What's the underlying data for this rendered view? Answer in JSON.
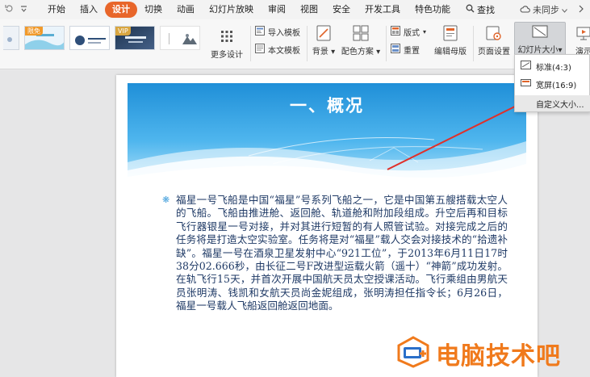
{
  "menubar": {
    "tabs": [
      {
        "label": "开始"
      },
      {
        "label": "插入"
      },
      {
        "label": "设计",
        "active": true
      },
      {
        "label": "切换"
      },
      {
        "label": "动画"
      },
      {
        "label": "幻灯片放映"
      },
      {
        "label": "审阅"
      },
      {
        "label": "视图"
      },
      {
        "label": "安全"
      },
      {
        "label": "开发工具"
      },
      {
        "label": "特色功能"
      }
    ],
    "search_label": "查找",
    "sync_label": "未同步",
    "accent_color": "#e8662a"
  },
  "ribbon": {
    "themes": [
      {
        "badge": "限免"
      },
      {
        "badge": ""
      },
      {
        "badge": "VIP"
      },
      {
        "badge": ""
      }
    ],
    "more_design": "更多设计",
    "import_template": "导入模板",
    "text_template": "本文模板",
    "background": "背景",
    "color_scheme": "配色方案",
    "layout": "版式",
    "rearrange": "重置",
    "edit_master": "编辑母版",
    "page_setup": "页面设置",
    "slide_size": "幻灯片大小",
    "presenter": "演示"
  },
  "dropdown": {
    "items": [
      {
        "label": "标准(4:3)"
      },
      {
        "label": "宽屏(16:9)"
      },
      {
        "label": "自定义大小..."
      }
    ]
  },
  "slide": {
    "title": "一、概况",
    "body": "福星一号飞船是中国“福星”号系列飞船之一，它是中国第五艘搭载太空人的飞船。飞船由推进舱、返回舱、轨道舱和附加段组成。升空后再和目标飞行器银星一号对接，并对其进行短暂的有人照管试验。对接完成之后的任务将是打造太空实验室。任务将是对“福星”载人交会对接技术的“拾遗补缺”。福星一号在酒泉卫星发射中心“921工位”，于2013年6月11日17时38分02.666秒，由长征二号F改进型运载火箭（遥十）“神箭”成功发射。在轨飞行15天，并首次开展中国航天员太空授课活动。飞行乘组由男航天员张明涛、钱凯和女航天员尚金妮组成，张明涛担任指令长；6月26日，福星一号载人飞船返回舱返回地面。"
  },
  "watermark": {
    "text": "电脑技术吧",
    "color": "#f07a1c"
  }
}
